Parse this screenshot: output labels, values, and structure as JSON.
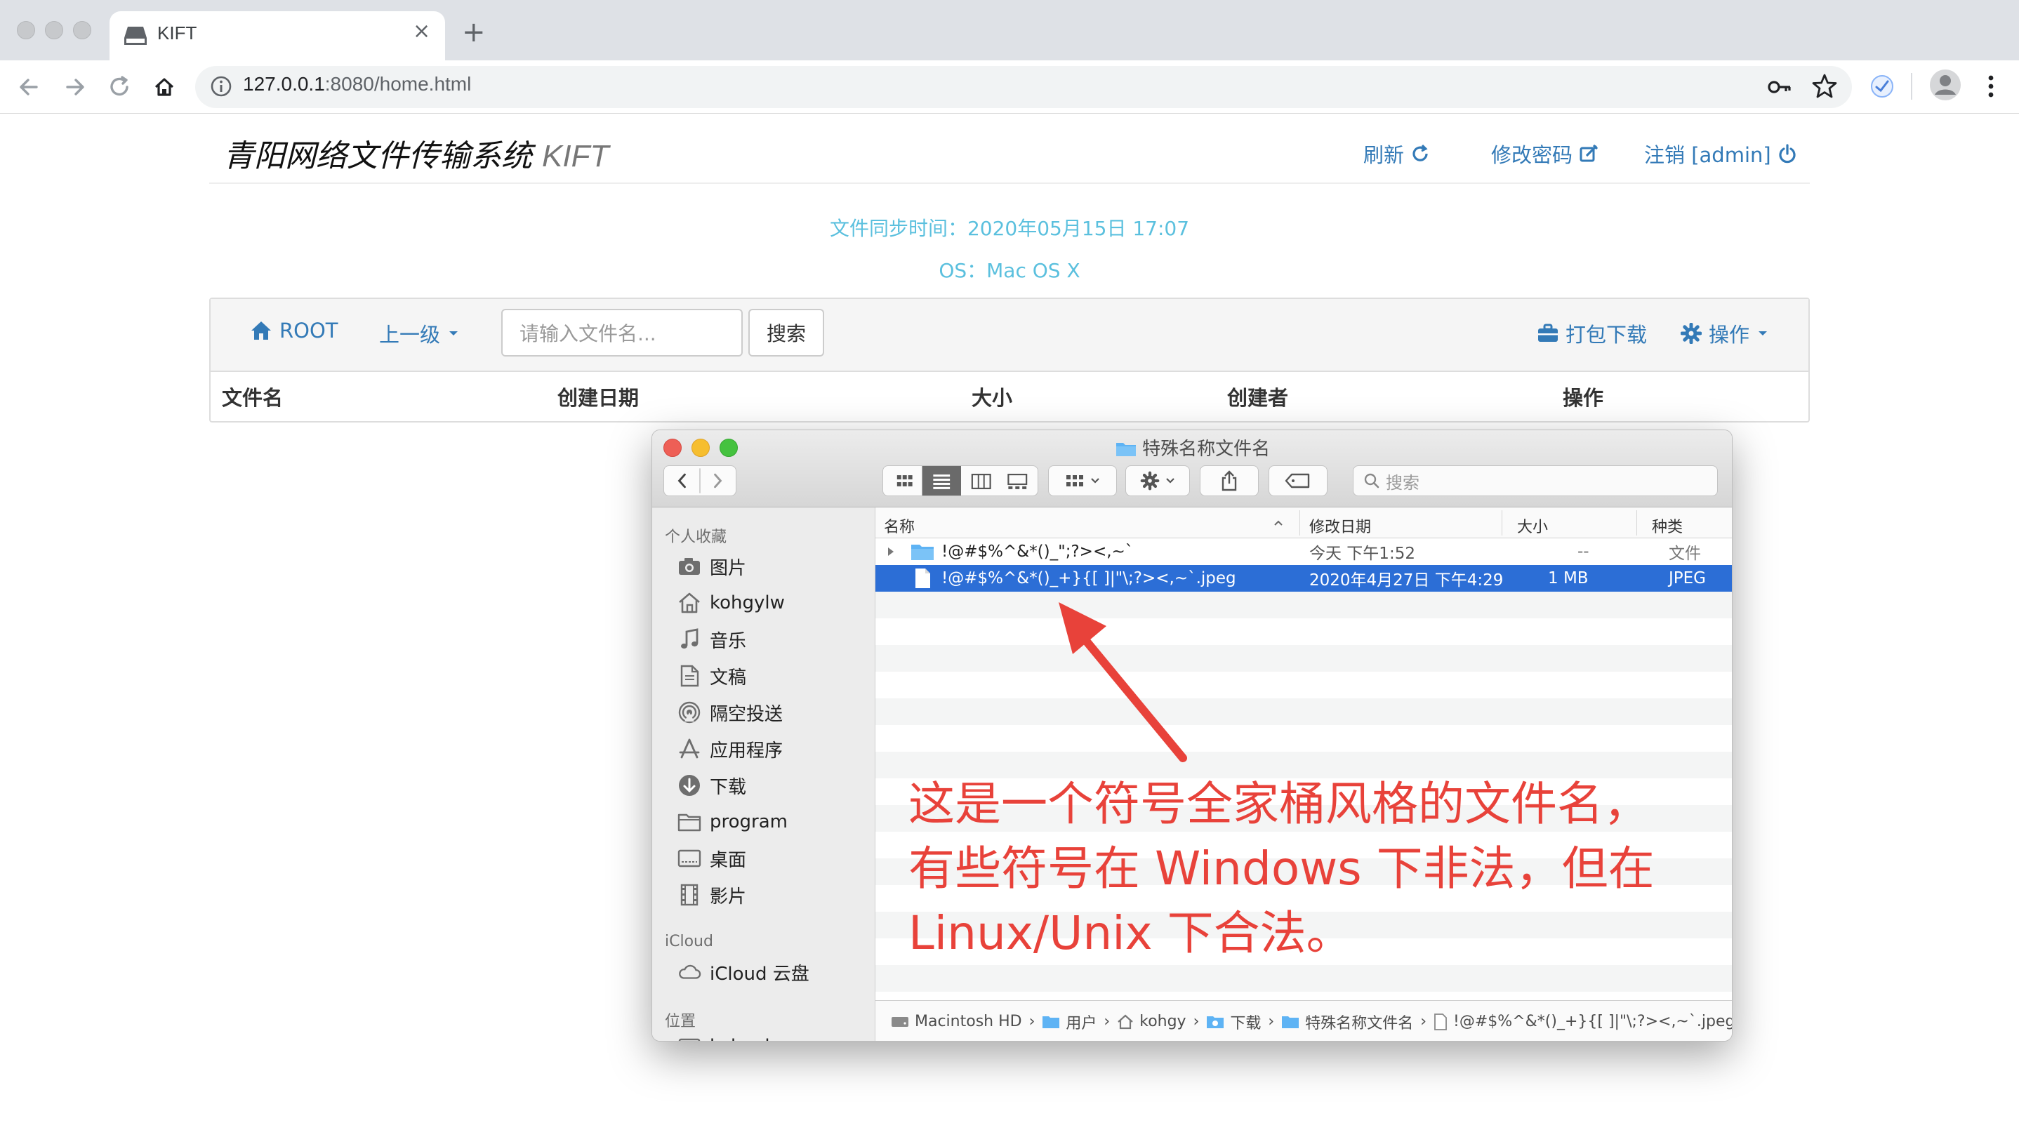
{
  "browser": {
    "tab_title": "KIFT",
    "tab_close": "×",
    "new_tab": "+",
    "url_host": "127.0.0.1",
    "url_rest": ":8080/home.html"
  },
  "header": {
    "title": "青阳网络文件传输系统",
    "title_suffix": "KIFT",
    "refresh": "刷新",
    "change_password": "修改密码",
    "logout": "注销 [admin]"
  },
  "info": {
    "sync_time": "文件同步时间：2020年05月15日 17:07",
    "os": "OS：Mac OS X"
  },
  "panel": {
    "root": "ROOT",
    "parent": "上一级",
    "search_placeholder": "请输入文件名...",
    "search_button": "搜索",
    "pack_download": "打包下载",
    "operations": "操作",
    "columns": [
      "文件名",
      "创建日期",
      "大小",
      "创建者",
      "操作"
    ]
  },
  "finder": {
    "title": "特殊名称文件名",
    "search_placeholder": "搜索",
    "sidebar": {
      "favorites_title": "个人收藏",
      "favorites": [
        {
          "label": "图片",
          "icon": "camera-icon"
        },
        {
          "label": "kohgylw",
          "icon": "home-icon"
        },
        {
          "label": "音乐",
          "icon": "music-icon"
        },
        {
          "label": "文稿",
          "icon": "document-icon"
        },
        {
          "label": "隔空投送",
          "icon": "airdrop-icon"
        },
        {
          "label": "应用程序",
          "icon": "apps-icon"
        },
        {
          "label": "下载",
          "icon": "download-icon"
        },
        {
          "label": "program",
          "icon": "folder-icon"
        },
        {
          "label": "桌面",
          "icon": "desktop-icon"
        },
        {
          "label": "影片",
          "icon": "film-icon"
        }
      ],
      "icloud_title": "iCloud",
      "icloud_item": "iCloud 云盘",
      "locations_title": "位置",
      "locations_item": "kohgylw"
    },
    "columns": {
      "name": "名称",
      "modified": "修改日期",
      "size": "大小",
      "kind": "种类"
    },
    "rows": [
      {
        "name": "!@#$%^&*()_\";?><,~`",
        "modified": "今天 下午1:52",
        "size": "--",
        "kind": "文件"
      },
      {
        "name": "!@#$%^&*()_+}{[ ]|\"\\;?><,~`.jpeg",
        "modified": "2020年4月27日 下午4:29",
        "size": "1 MB",
        "kind": "JPEG"
      }
    ],
    "path": [
      "Macintosh HD",
      "用户",
      "kohgy",
      "下载",
      "特殊名称文件名",
      "!@#$%^&*()_+}{[ ]|\"\\;?><,~`.jpeg"
    ],
    "path_sep": "›"
  },
  "annotation": {
    "line1": "这是一个符号全家桶风格的文件名，",
    "line2": "有些符号在 Windows 下非法，但在",
    "line3": "Linux/Unix 下合法。"
  },
  "colors": {
    "link": "#337ab7",
    "info": "#5bc0de",
    "annotation": "#e8423a",
    "selection": "#2c6ed6"
  }
}
